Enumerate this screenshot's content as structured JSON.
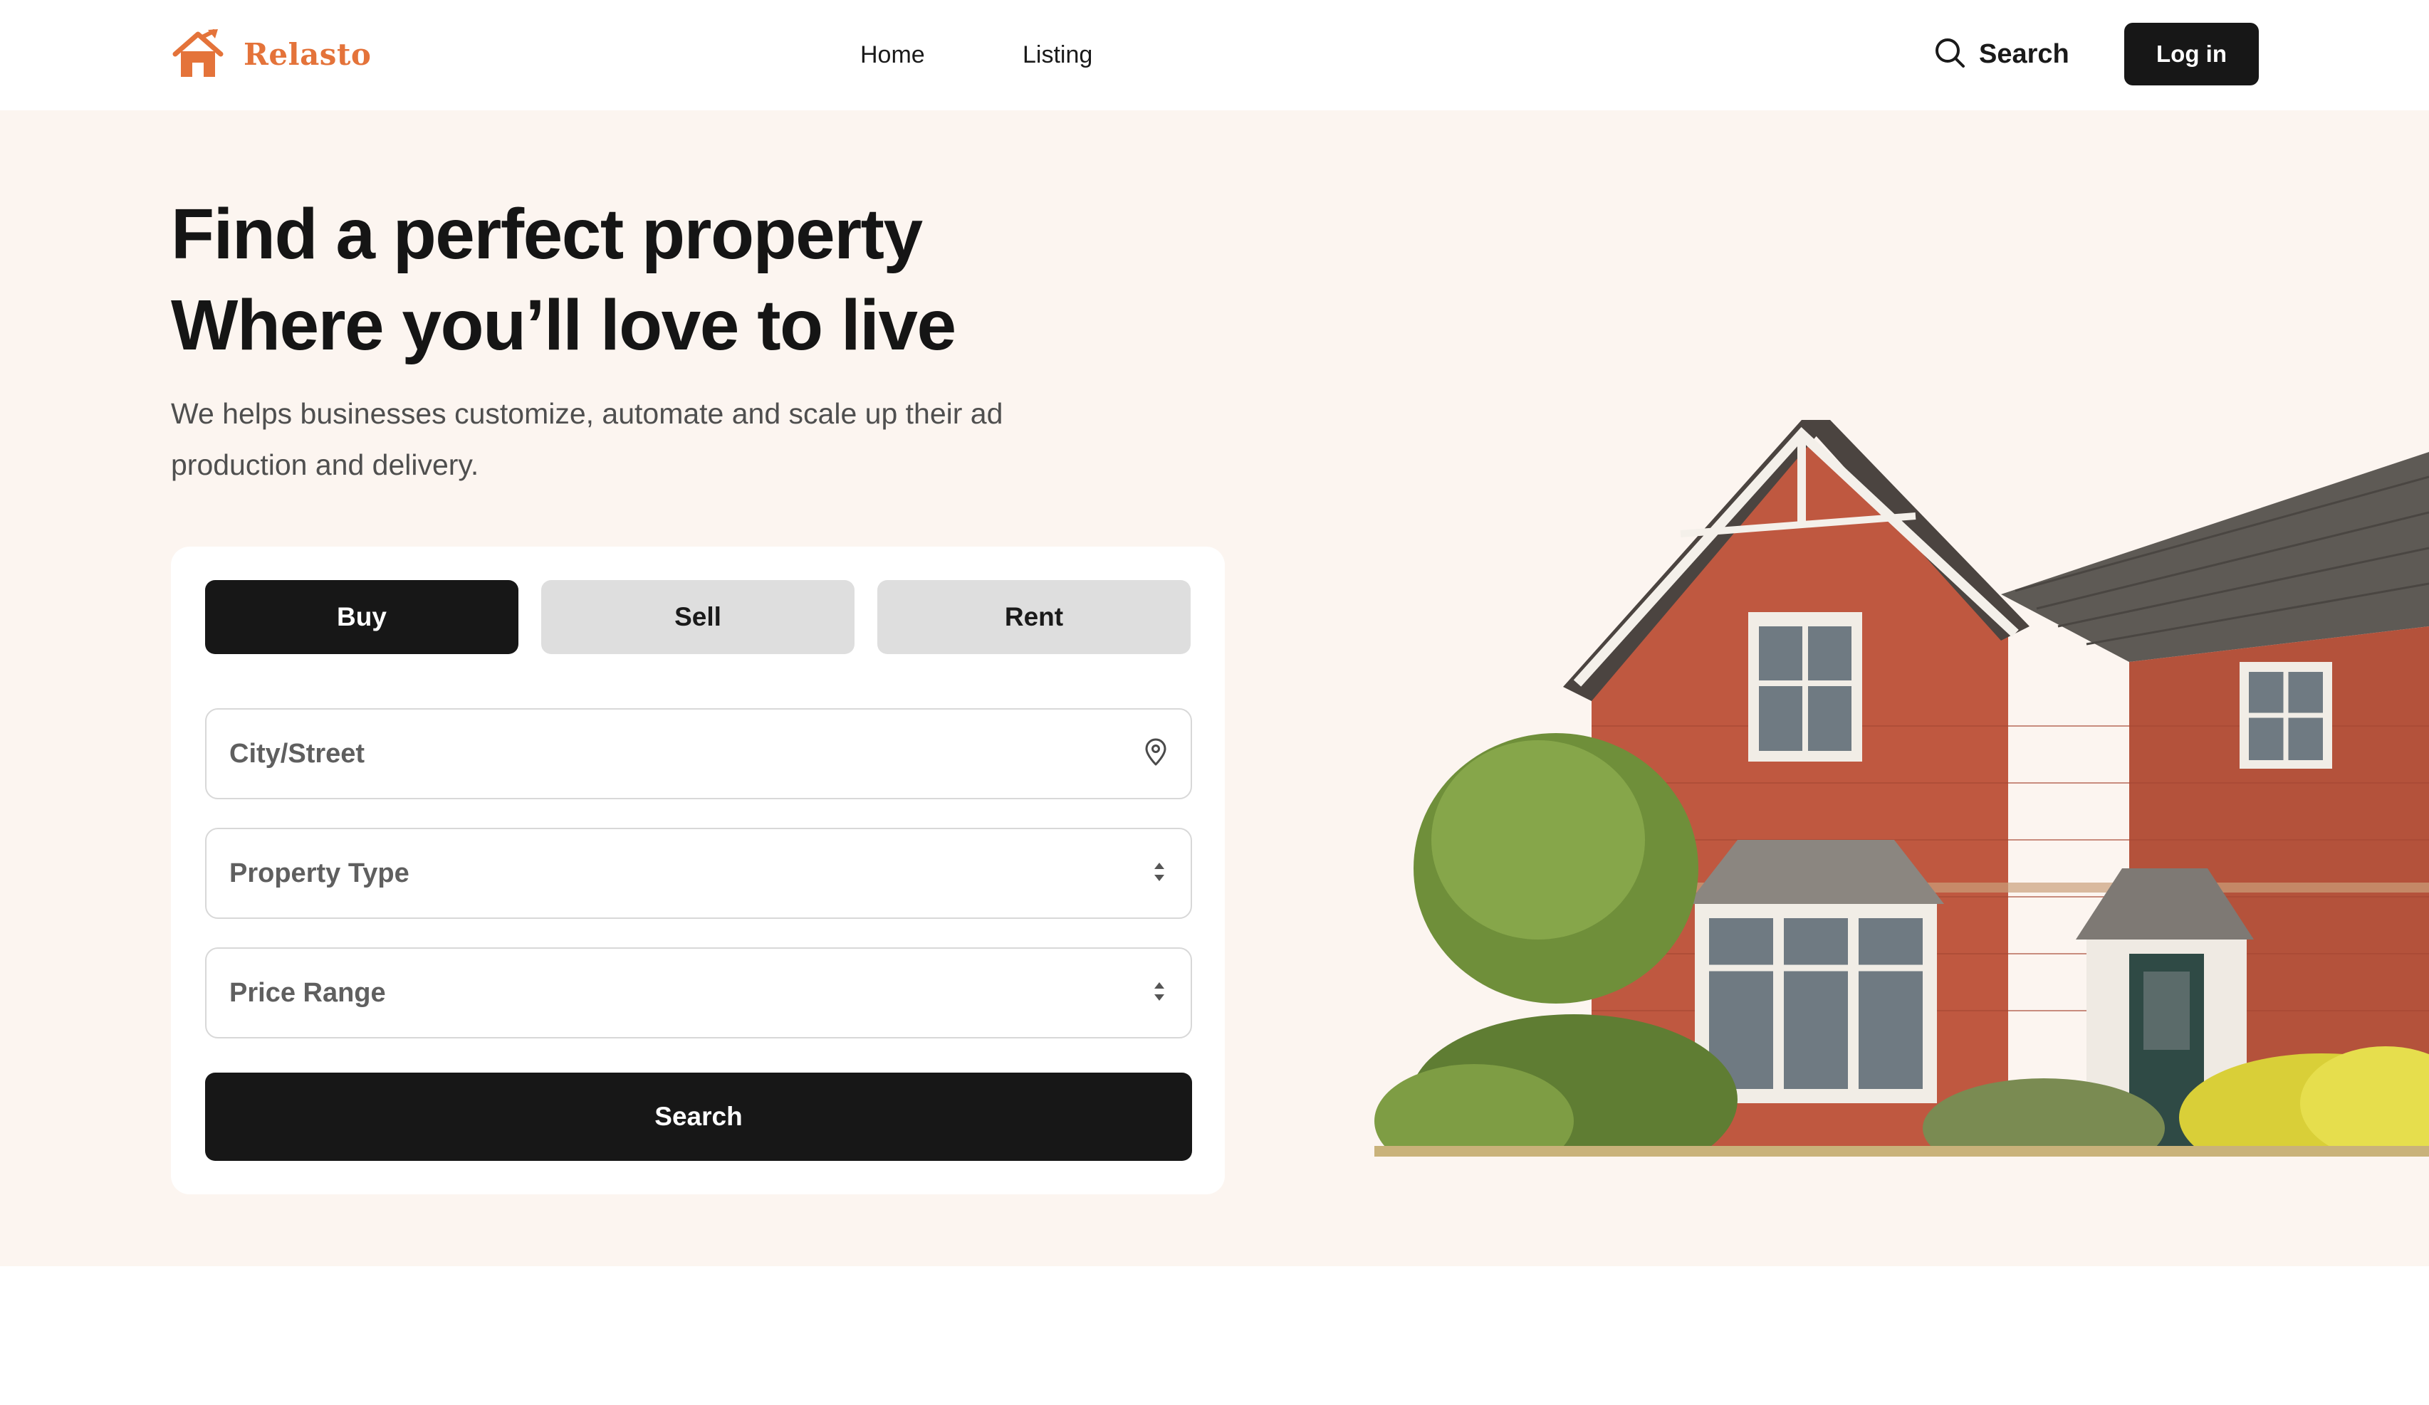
{
  "brand": {
    "name": "Relasto",
    "logo_icon": "house-chart-icon",
    "accent": "#e4733a"
  },
  "nav": {
    "home": "Home",
    "listing": "Listing"
  },
  "header": {
    "search_label": "Search",
    "search_icon": "search-icon",
    "login_label": "Log in"
  },
  "hero": {
    "title_line1": "Find a perfect property",
    "title_line2": "Where you’ll love to live",
    "subtitle_line1": "We helps businesses customize, automate and scale up their ad",
    "subtitle_line2": "production and delivery."
  },
  "search_form": {
    "tabs": [
      {
        "label": "Buy",
        "active": true
      },
      {
        "label": "Sell",
        "active": false
      },
      {
        "label": "Rent",
        "active": false
      }
    ],
    "city_placeholder": "City/Street",
    "city_icon": "location-pin-icon",
    "property_type_placeholder": "Property Type",
    "price_range_placeholder": "Price Range",
    "select_icon": "sort-arrows-icon",
    "submit_label": "Search"
  },
  "colors": {
    "hero_bg": "#fcf5f0",
    "dark_button": "#171717",
    "inactive_tab": "#dedede"
  }
}
